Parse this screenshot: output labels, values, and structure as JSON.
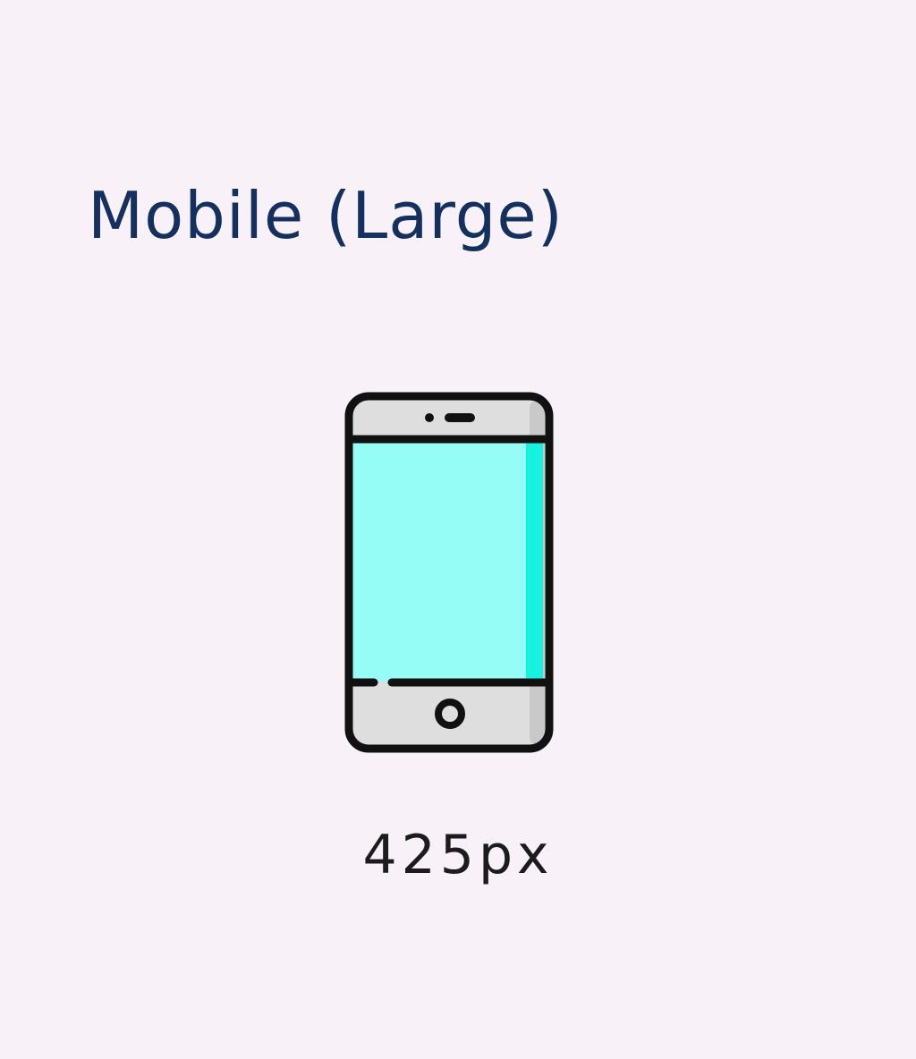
{
  "title": "Mobile (Large)",
  "icon": "smartphone-icon",
  "width_label": "425px",
  "colors": {
    "background": "#f8f2f8",
    "title": "#14305e",
    "caption": "#1c1c1c",
    "phone_outline": "#111111",
    "phone_body": "#dedede",
    "phone_body_shade": "#c9c9c9",
    "screen": "#96fcf6",
    "screen_edge": "#16f2de"
  }
}
